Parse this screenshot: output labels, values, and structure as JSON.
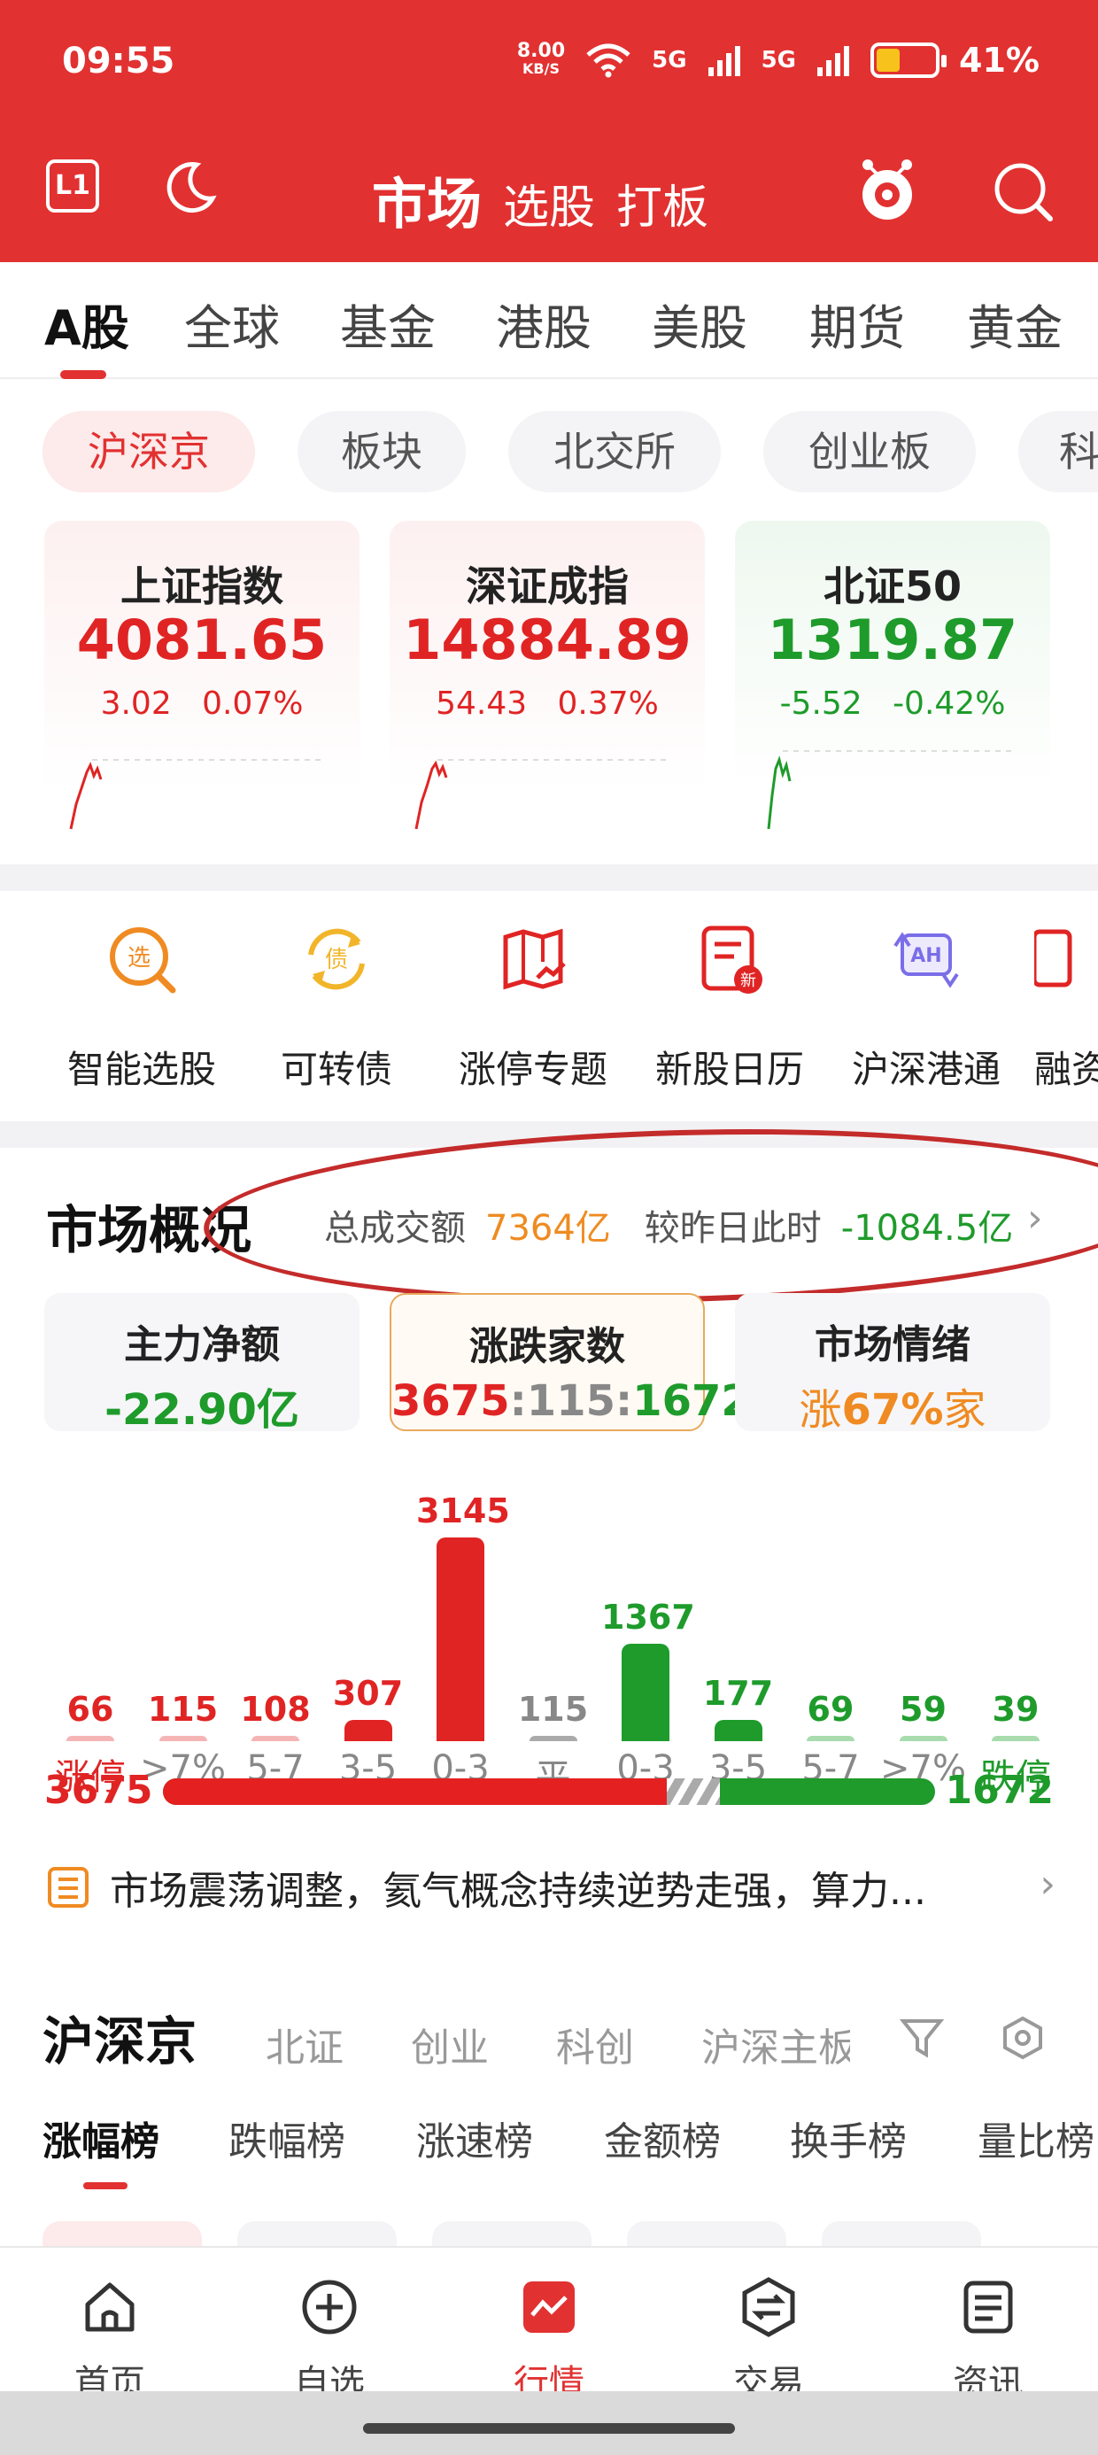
{
  "status": {
    "time": "09:55",
    "net_speed_value": "8.00",
    "net_speed_unit": "KB/S",
    "signal1": "5G",
    "signal2": "5G",
    "battery": "41%",
    "battery_level": 0.41
  },
  "header": {
    "title": "市场",
    "link1": "选股",
    "link2": "打板",
    "l1_label": "L1"
  },
  "tabs": [
    "A股",
    "全球",
    "基金",
    "港股",
    "美股",
    "期货",
    "黄金"
  ],
  "chips": [
    "沪深京",
    "板块",
    "北交所",
    "创业板",
    "科"
  ],
  "indices": [
    {
      "name": "上证指数",
      "value": "4081.65",
      "change": "3.02",
      "pct": "0.07%",
      "trend": "up"
    },
    {
      "name": "深证成指",
      "value": "14884.89",
      "change": "54.43",
      "pct": "0.37%",
      "trend": "up"
    },
    {
      "name": "北证50",
      "value": "1319.87",
      "change": "-5.52",
      "pct": "-0.42%",
      "trend": "down"
    }
  ],
  "tools": [
    "智能选股",
    "可转债",
    "涨停专题",
    "新股日历",
    "沪深港通",
    "融资"
  ],
  "overview": {
    "title": "市场概况",
    "turnover_label": "总成交额",
    "turnover_value": "7364亿",
    "compare_label": "较昨日此时",
    "compare_value": "-1084.5亿",
    "cards": [
      {
        "label": "主力净额",
        "value": "-22.90亿"
      },
      {
        "label": "涨跌家数",
        "value_up": "3675",
        "sep": ":",
        "value_flat": "115",
        "value_down": "1672"
      },
      {
        "label": "市场情绪",
        "value_prefix": "涨",
        "value_pct": "67%",
        "value_suffix": "家"
      }
    ]
  },
  "chart_data": {
    "type": "bar",
    "categories": [
      "涨停",
      ">7%",
      "5-7",
      "3-5",
      "0-3",
      "平",
      "0-3",
      "3-5",
      "5-7",
      ">7%",
      "跌停"
    ],
    "values": [
      66,
      115,
      108,
      307,
      3145,
      115,
      1367,
      177,
      69,
      59,
      39
    ],
    "colors": [
      "#e02424",
      "#e02424",
      "#e02424",
      "#e02424",
      "#e02424",
      "#888888",
      "#1e9b2b",
      "#1e9b2b",
      "#1e9b2b",
      "#1e9b2b",
      "#1e9b2b"
    ]
  },
  "ratio": {
    "up": "3675",
    "down": "1672",
    "up_fraction": 0.687
  },
  "news": "市场震荡调整，氦气概念持续逆势走强，算力...",
  "ranking": {
    "title": "沪深京",
    "subs": [
      "北证",
      "创业",
      "科创",
      "沪深主板"
    ],
    "tabs": [
      "涨幅榜",
      "跌幅榜",
      "涨速榜",
      "金额榜",
      "换手榜",
      "量比榜"
    ]
  },
  "nav": [
    "首页",
    "自选",
    "行情",
    "交易",
    "资讯"
  ],
  "colors": {
    "brand": "#e23131",
    "up": "#e02424",
    "down": "#1e9b2b",
    "accent": "#ef8b22"
  }
}
